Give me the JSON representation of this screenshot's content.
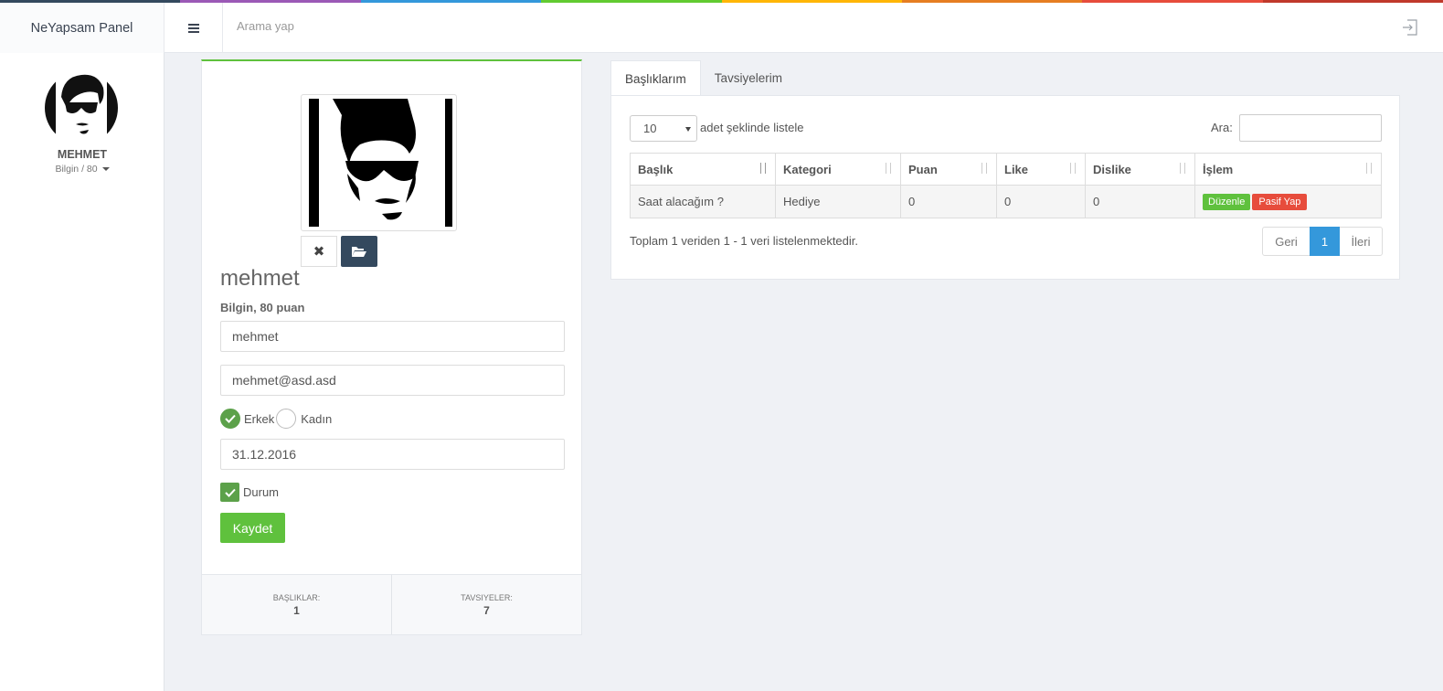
{
  "colors": {
    "rainbow": [
      "#34495e",
      "#9b59b6",
      "#3498db",
      "#62cb31",
      "#ffb606",
      "#e67e22",
      "#e74c3c",
      "#c0392b"
    ],
    "accent_green": "#5fc13d",
    "accent_blue": "#3498db",
    "danger": "#e74c3c"
  },
  "topbar": {
    "brand": "NeYapsam Panel",
    "search_placeholder": "Arama yap",
    "menu_icon": "hamburger-icon",
    "logout_icon": "logout-icon"
  },
  "sidebar": {
    "username": "MEHMET",
    "role": "Bilgin / 80"
  },
  "profile": {
    "name": "mehmet",
    "level": "Bilgin, 80 puan",
    "username_value": "mehmet",
    "email_value": "mehmet@asd.asd",
    "gender_options": [
      "Erkek",
      "Kadın"
    ],
    "gender_selected": "Erkek",
    "birthdate_value": "31.12.2016",
    "status_label": "Durum",
    "status_checked": true,
    "save_label": "Kaydet",
    "stats": [
      {
        "label": "BAŞLIKLAR:",
        "value": "1"
      },
      {
        "label": "TAVSIYELER:",
        "value": "7"
      }
    ]
  },
  "tabs": [
    "Başlıklarım",
    "Tavsiyelerim"
  ],
  "table": {
    "length_value": "10",
    "length_label": "adet şeklinde listele",
    "search_label": "Ara:",
    "columns": [
      "Başlık",
      "Kategori",
      "Puan",
      "Like",
      "Dislike",
      "İşlem"
    ],
    "rows": [
      {
        "baslik": "Saat alacağım ?",
        "kategori": "Hediye",
        "puan": "0",
        "like": "0",
        "dislike": "0",
        "edit": "Düzenle",
        "passive": "Pasif Yap"
      }
    ],
    "info": "Toplam 1 veriden 1 - 1 veri listelenmektedir.",
    "pager": {
      "prev": "Geri",
      "current": "1",
      "next": "İleri"
    }
  }
}
